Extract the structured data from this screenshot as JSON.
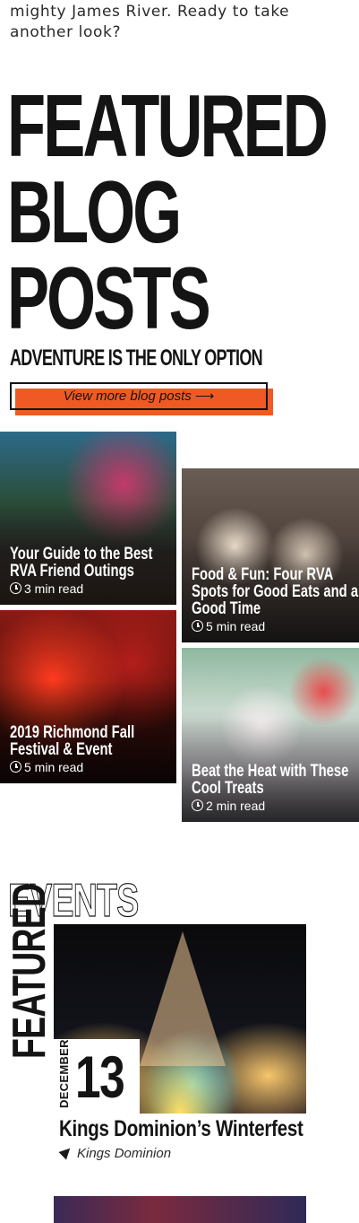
{
  "intro": {
    "text": "mighty James River. Ready to take another look?"
  },
  "featured_blog": {
    "title_lines": [
      "FEATURED",
      "BLOG",
      "POSTS"
    ],
    "tagline": "ADVENTURE IS THE ONLY OPTION",
    "cta_label": "View more blog posts"
  },
  "posts": [
    {
      "title": "Your Guide to the Best RVA Friend Outings",
      "read_time": "3 min read"
    },
    {
      "title": "Food & Fun: Four RVA Spots for Good Eats and a Good Time",
      "read_time": "5 min read"
    },
    {
      "title": "2019 Richmond Fall Festival & Event",
      "read_time": "5 min read"
    },
    {
      "title": "Beat the Heat with These Cool Treats",
      "read_time": "2 min read"
    }
  ],
  "featured_events": {
    "heading_outline": "EVENTS",
    "heading_vertical": "FEATURED",
    "event": {
      "month": "DECEMBER",
      "day": "13",
      "title": "Kings Dominion’s Winterfest",
      "location": "Kings Dominion"
    }
  },
  "colors": {
    "accent": "#ef5a24",
    "text": "#141414"
  },
  "icons": {
    "read_time": "clock-icon",
    "cta": "arrow-right-icon",
    "location": "location-arrow-icon"
  }
}
